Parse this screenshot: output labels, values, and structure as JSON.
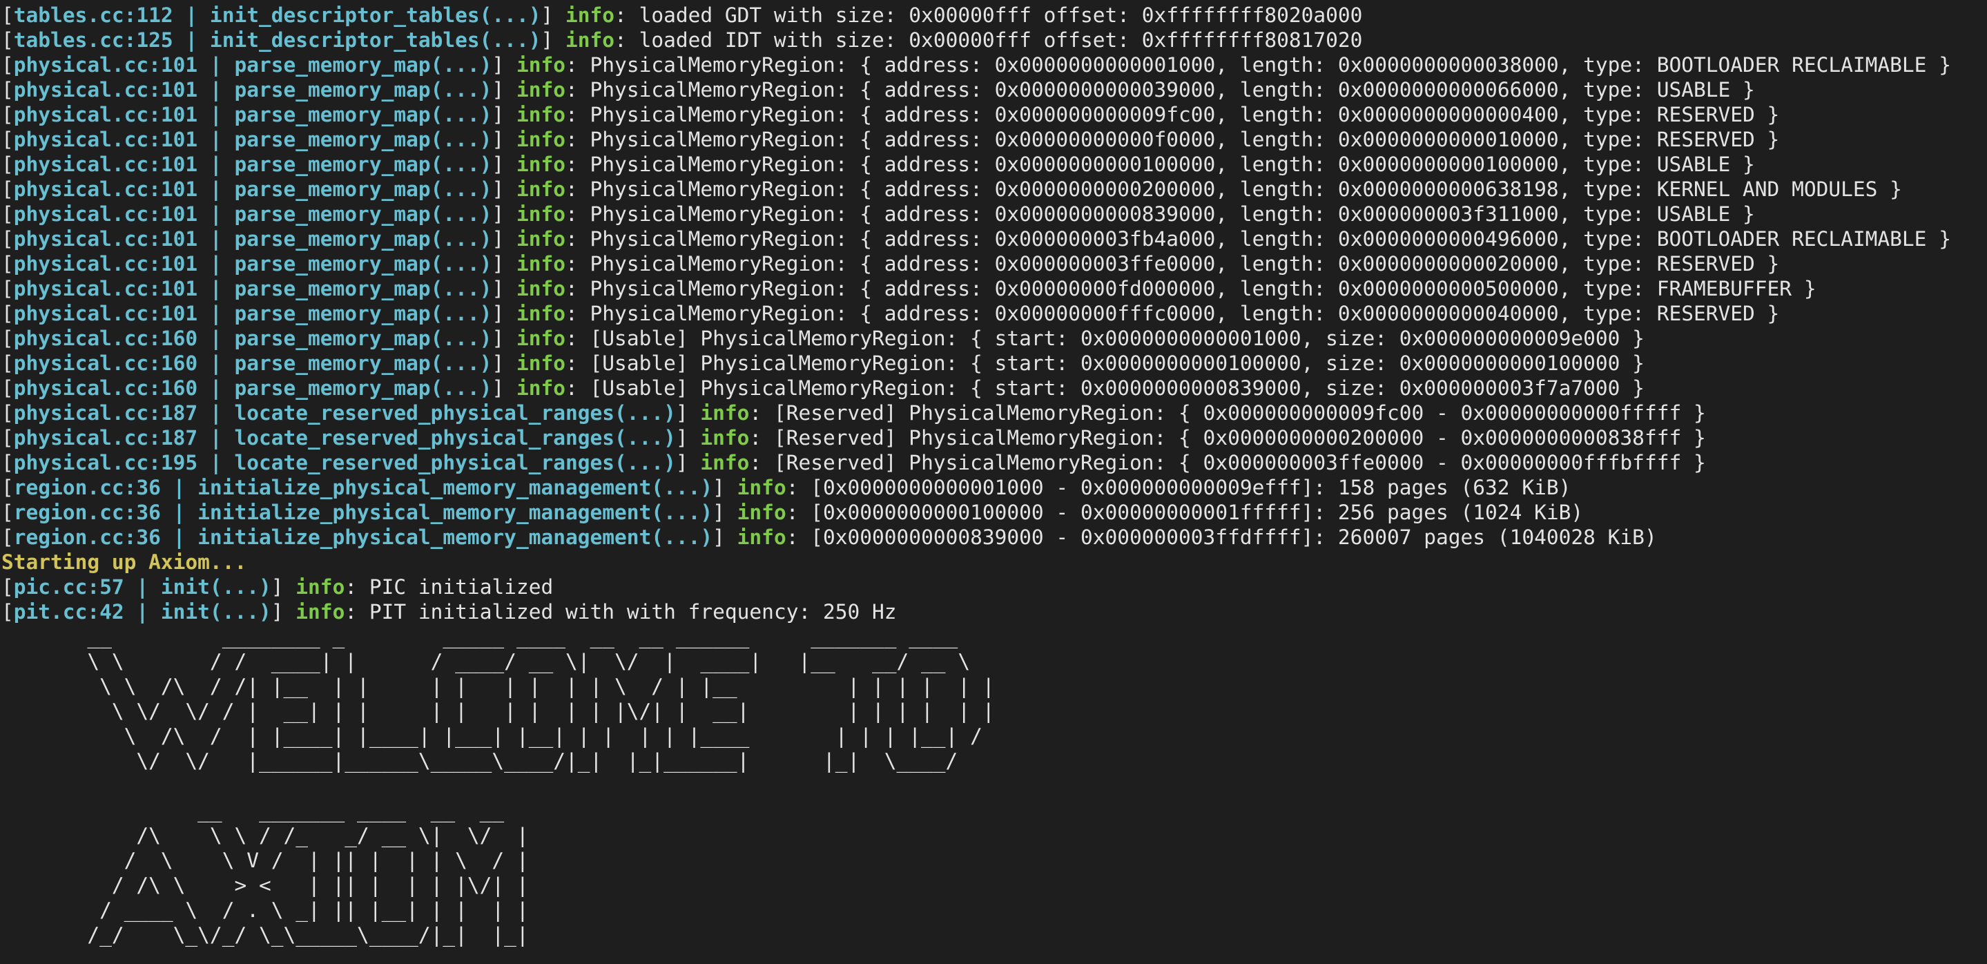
{
  "colors": {
    "background": "#1e1e1e",
    "foreground": "#e4e4e4",
    "source": "#68bfd2",
    "level": "#7fc94b",
    "boot": "#d2c45a"
  },
  "lines": [
    {
      "src": "tables.cc:112 | init_descriptor_tables(...)",
      "level": "info",
      "msg": ": loaded GDT with size: 0x00000fff offset: 0xffffffff8020a000"
    },
    {
      "src": "tables.cc:125 | init_descriptor_tables(...)",
      "level": "info",
      "msg": ": loaded IDT with size: 0x00000fff offset: 0xffffffff80817020"
    },
    {
      "src": "physical.cc:101 | parse_memory_map(...)",
      "level": "info",
      "msg": ": PhysicalMemoryRegion: { address: 0x0000000000001000, length: 0x0000000000038000, type: BOOTLOADER RECLAIMABLE }"
    },
    {
      "src": "physical.cc:101 | parse_memory_map(...)",
      "level": "info",
      "msg": ": PhysicalMemoryRegion: { address: 0x0000000000039000, length: 0x0000000000066000, type: USABLE }"
    },
    {
      "src": "physical.cc:101 | parse_memory_map(...)",
      "level": "info",
      "msg": ": PhysicalMemoryRegion: { address: 0x000000000009fc00, length: 0x0000000000000400, type: RESERVED }"
    },
    {
      "src": "physical.cc:101 | parse_memory_map(...)",
      "level": "info",
      "msg": ": PhysicalMemoryRegion: { address: 0x00000000000f0000, length: 0x0000000000010000, type: RESERVED }"
    },
    {
      "src": "physical.cc:101 | parse_memory_map(...)",
      "level": "info",
      "msg": ": PhysicalMemoryRegion: { address: 0x0000000000100000, length: 0x0000000000100000, type: USABLE }"
    },
    {
      "src": "physical.cc:101 | parse_memory_map(...)",
      "level": "info",
      "msg": ": PhysicalMemoryRegion: { address: 0x0000000000200000, length: 0x0000000000638198, type: KERNEL AND MODULES }"
    },
    {
      "src": "physical.cc:101 | parse_memory_map(...)",
      "level": "info",
      "msg": ": PhysicalMemoryRegion: { address: 0x0000000000839000, length: 0x000000003f311000, type: USABLE }"
    },
    {
      "src": "physical.cc:101 | parse_memory_map(...)",
      "level": "info",
      "msg": ": PhysicalMemoryRegion: { address: 0x000000003fb4a000, length: 0x0000000000496000, type: BOOTLOADER RECLAIMABLE }"
    },
    {
      "src": "physical.cc:101 | parse_memory_map(...)",
      "level": "info",
      "msg": ": PhysicalMemoryRegion: { address: 0x000000003ffe0000, length: 0x0000000000020000, type: RESERVED }"
    },
    {
      "src": "physical.cc:101 | parse_memory_map(...)",
      "level": "info",
      "msg": ": PhysicalMemoryRegion: { address: 0x00000000fd000000, length: 0x0000000000500000, type: FRAMEBUFFER }"
    },
    {
      "src": "physical.cc:101 | parse_memory_map(...)",
      "level": "info",
      "msg": ": PhysicalMemoryRegion: { address: 0x00000000fffc0000, length: 0x0000000000040000, type: RESERVED }"
    },
    {
      "src": "physical.cc:160 | parse_memory_map(...)",
      "level": "info",
      "msg": ": [Usable] PhysicalMemoryRegion: { start: 0x0000000000001000, size: 0x000000000009e000 }"
    },
    {
      "src": "physical.cc:160 | parse_memory_map(...)",
      "level": "info",
      "msg": ": [Usable] PhysicalMemoryRegion: { start: 0x0000000000100000, size: 0x0000000000100000 }"
    },
    {
      "src": "physical.cc:160 | parse_memory_map(...)",
      "level": "info",
      "msg": ": [Usable] PhysicalMemoryRegion: { start: 0x0000000000839000, size: 0x000000003f7a7000 }"
    },
    {
      "src": "physical.cc:187 | locate_reserved_physical_ranges(...)",
      "level": "info",
      "msg": ": [Reserved] PhysicalMemoryRegion: { 0x000000000009fc00 - 0x00000000000fffff }"
    },
    {
      "src": "physical.cc:187 | locate_reserved_physical_ranges(...)",
      "level": "info",
      "msg": ": [Reserved] PhysicalMemoryRegion: { 0x0000000000200000 - 0x0000000000838fff }"
    },
    {
      "src": "physical.cc:195 | locate_reserved_physical_ranges(...)",
      "level": "info",
      "msg": ": [Reserved] PhysicalMemoryRegion: { 0x000000003ffe0000 - 0x00000000fffbffff }"
    },
    {
      "src": "region.cc:36 | initialize_physical_memory_management(...)",
      "level": "info",
      "msg": ": [0x0000000000001000 - 0x000000000009efff]: 158 pages (632 KiB)"
    },
    {
      "src": "region.cc:36 | initialize_physical_memory_management(...)",
      "level": "info",
      "msg": ": [0x0000000000100000 - 0x00000000001fffff]: 256 pages (1024 KiB)"
    },
    {
      "src": "region.cc:36 | initialize_physical_memory_management(...)",
      "level": "info",
      "msg": ": [0x0000000000839000 - 0x000000003ffdffff]: 260007 pages (1040028 KiB)"
    },
    {
      "boot": "Starting up Axiom..."
    },
    {
      "src": "pic.cc:57 | init(...)",
      "level": "info",
      "msg": ": PIC initialized"
    },
    {
      "src": "pit.cc:42 | init(...)",
      "level": "info",
      "msg": ": PIT initialized with with frequency: 250 Hz"
    }
  ],
  "banner": {
    "welcome": "       __         ________ _        _____ ____  __  __ ______     _______ ____\n       \\ \\       / /  ____| |      / ____/ __ \\|  \\/  |  ____|   |__   __/ __ \\\n        \\ \\  /\\  / /| |__  | |     | |   | |  | | \\  / | |__         | | | |  | |\n         \\ \\/  \\/ / |  __| | |     | |   | |  | | |\\/| |  __|        | | | |  | |\n          \\  /\\  /  | |____| |____| |___| |__| | |  | | |____       | | | |__| /\n           \\/  \\/   |______|______\\_____\\____/|_|  |_|______|      |_|  \\____/",
    "axiom": "                __   _______ ____  __  __\n           /\\    \\ \\ / /_   _/ __ \\|  \\/  |\n          /  \\    \\ V /  | || |  | | \\  / |\n         / /\\ \\    > <   | || |  | | |\\/| |\n        / ____ \\  / . \\ _| || |__| | |  | |\n       /_/    \\_\\/_/ \\_\\_____\\____/|_|  |_|"
  }
}
